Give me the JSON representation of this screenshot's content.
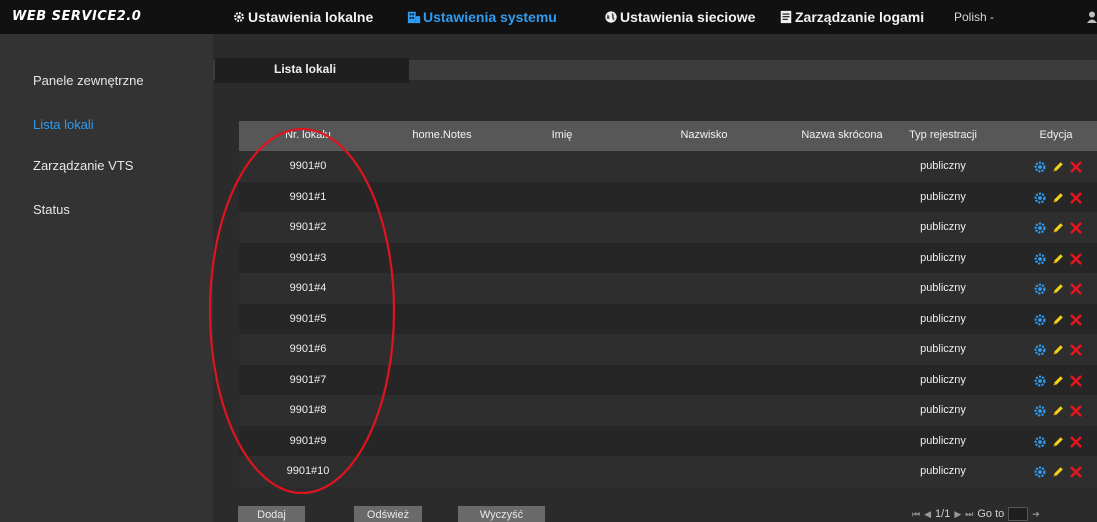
{
  "header": {
    "brand": "WEB SERVICE2.0",
    "tabs": [
      {
        "id": "local-settings",
        "label": "Ustawienia lokalne",
        "icon": "gear-icon",
        "active": false
      },
      {
        "id": "system-settings",
        "label": "Ustawienia systemu",
        "icon": "building-icon",
        "active": true
      },
      {
        "id": "network-settings",
        "label": "Ustawienia sieciowe",
        "icon": "globe-icon",
        "active": false
      },
      {
        "id": "log-management",
        "label": "Zarządzanie logami",
        "icon": "document-icon",
        "active": false
      }
    ],
    "language": "Polish -",
    "accent_color": "#2e9cf0"
  },
  "sidebar": {
    "items": [
      {
        "id": "outdoor-panels",
        "label": "Panele zewnętrzne",
        "active": false
      },
      {
        "id": "room-list",
        "label": "Lista lokali",
        "active": true
      },
      {
        "id": "vts-management",
        "label": "Zarządzanie VTS",
        "active": false
      },
      {
        "id": "status",
        "label": "Status",
        "active": false
      }
    ]
  },
  "main": {
    "tab_label": "Lista lokali",
    "table": {
      "columns": [
        "Nr. lokalu",
        "home.Notes",
        "Imię",
        "Nazwisko",
        "Nazwa skrócona",
        "Typ rejestracji",
        "Edycja"
      ],
      "rows": [
        {
          "room": "9901#0",
          "notes": "",
          "first_name": "",
          "last_name": "",
          "short_name": "",
          "reg_type": "publiczny"
        },
        {
          "room": "9901#1",
          "notes": "",
          "first_name": "",
          "last_name": "",
          "short_name": "",
          "reg_type": "publiczny"
        },
        {
          "room": "9901#2",
          "notes": "",
          "first_name": "",
          "last_name": "",
          "short_name": "",
          "reg_type": "publiczny"
        },
        {
          "room": "9901#3",
          "notes": "",
          "first_name": "",
          "last_name": "",
          "short_name": "",
          "reg_type": "publiczny"
        },
        {
          "room": "9901#4",
          "notes": "",
          "first_name": "",
          "last_name": "",
          "short_name": "",
          "reg_type": "publiczny"
        },
        {
          "room": "9901#5",
          "notes": "",
          "first_name": "",
          "last_name": "",
          "short_name": "",
          "reg_type": "publiczny"
        },
        {
          "room": "9901#6",
          "notes": "",
          "first_name": "",
          "last_name": "",
          "short_name": "",
          "reg_type": "publiczny"
        },
        {
          "room": "9901#7",
          "notes": "",
          "first_name": "",
          "last_name": "",
          "short_name": "",
          "reg_type": "publiczny"
        },
        {
          "room": "9901#8",
          "notes": "",
          "first_name": "",
          "last_name": "",
          "short_name": "",
          "reg_type": "publiczny"
        },
        {
          "room": "9901#9",
          "notes": "",
          "first_name": "",
          "last_name": "",
          "short_name": "",
          "reg_type": "publiczny"
        },
        {
          "room": "9901#10",
          "notes": "",
          "first_name": "",
          "last_name": "",
          "short_name": "",
          "reg_type": "publiczny"
        }
      ],
      "row_actions": [
        "gear-icon",
        "pencil-icon",
        "delete-x-icon"
      ]
    },
    "buttons": {
      "add": "Dodaj",
      "refresh": "Odśwież",
      "clear": "Wyczyść"
    },
    "pagination": {
      "page_text": "1/1",
      "goto_label": "Go to",
      "goto_value": ""
    }
  },
  "annotation": {
    "shape": "ellipse",
    "color": "#e0141e"
  }
}
